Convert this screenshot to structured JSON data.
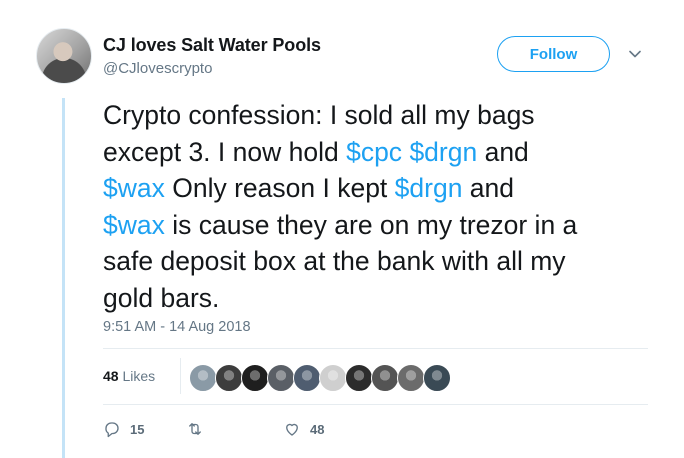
{
  "author": {
    "display_name": "CJ loves Salt Water Pools",
    "handle": "@CJlovescrypto",
    "avatar_icon": "profile-photo"
  },
  "follow_label": "Follow",
  "tweet": {
    "lines": [
      [
        {
          "t": "Crypto confession: I sold all my bags",
          "tag": false
        }
      ],
      [
        {
          "t": "except 3. I now hold ",
          "tag": false
        },
        {
          "t": "$cpc",
          "tag": true
        },
        {
          "t": " ",
          "tag": false
        },
        {
          "t": "$drgn",
          "tag": true
        },
        {
          "t": " and",
          "tag": false
        }
      ],
      [
        {
          "t": "$wax",
          "tag": true
        },
        {
          "t": "  Only reason I kept ",
          "tag": false
        },
        {
          "t": "$drgn",
          "tag": true
        },
        {
          "t": " and",
          "tag": false
        }
      ],
      [
        {
          "t": "$wax",
          "tag": true
        },
        {
          "t": " is cause they are on my trezor in a",
          "tag": false
        }
      ],
      [
        {
          "t": "safe deposit box at the bank with all my",
          "tag": false
        }
      ],
      [
        {
          "t": "gold bars.",
          "tag": false
        }
      ]
    ],
    "timestamp": "9:51 AM - 14 Aug 2018"
  },
  "stats": {
    "likes_count": "48",
    "likes_label": "Likes",
    "liker_avatars": [
      "#8a9aa6",
      "#3d3d3d",
      "#1f1f1f",
      "#5a5f66",
      "#4f5d70",
      "#cfcfcf",
      "#2c2c2c",
      "#545454",
      "#6b6b6b",
      "#3a4a55"
    ]
  },
  "actions": {
    "reply_count": "15",
    "retweet_count": "",
    "like_count": "48"
  },
  "colors": {
    "accent": "#1da1f2",
    "muted": "#657786",
    "thread_line": "#c4e3f7"
  }
}
